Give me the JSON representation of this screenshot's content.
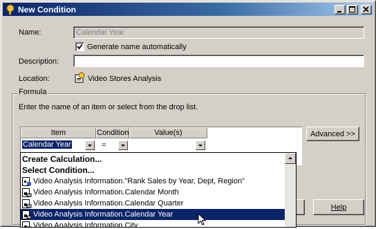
{
  "window": {
    "title": "New Condition"
  },
  "form": {
    "name_label": "Name:",
    "name_value": "Calendar Year",
    "auto_name_label": "Generate name automatically",
    "auto_name_checked": true,
    "description_label": "Description:",
    "description_value": "",
    "location_label": "Location:",
    "location_value": "Video Stores Analysis"
  },
  "formula": {
    "group_label": "Formula",
    "instructions": "Enter the name of an item or select from the drop list.",
    "advanced_button": "Advanced >>",
    "columns": [
      "Item",
      "Condition",
      "Value(s)"
    ],
    "row": {
      "item": "Calendar Year",
      "condition": "=",
      "value": ""
    }
  },
  "droplist": {
    "items": [
      {
        "label": "Create Calculation...",
        "bold": true,
        "icon": ""
      },
      {
        "label": "Select Condition...",
        "bold": true,
        "icon": ""
      },
      {
        "label": "Video Analysis Information.\"Rank Sales by Year, Dept, Region\"",
        "bold": false,
        "icon": "calculation-item-icon"
      },
      {
        "label": "Video Analysis Information.Calendar Month",
        "bold": false,
        "icon": "folder-item-icon"
      },
      {
        "label": "Video Analysis Information.Calendar Quarter",
        "bold": false,
        "icon": "folder-item-icon"
      },
      {
        "label": "Video Analysis Information.Calendar Year",
        "bold": false,
        "icon": "folder-item-icon",
        "selected": true
      },
      {
        "label": "Video Analysis Information.City",
        "bold": false,
        "icon": "folder-item-icon"
      }
    ]
  },
  "buttons": {
    "help": "Help"
  },
  "colors": {
    "titlebar": "#0a246a",
    "face": "#d4d0c8",
    "selection": "#0a246a"
  }
}
